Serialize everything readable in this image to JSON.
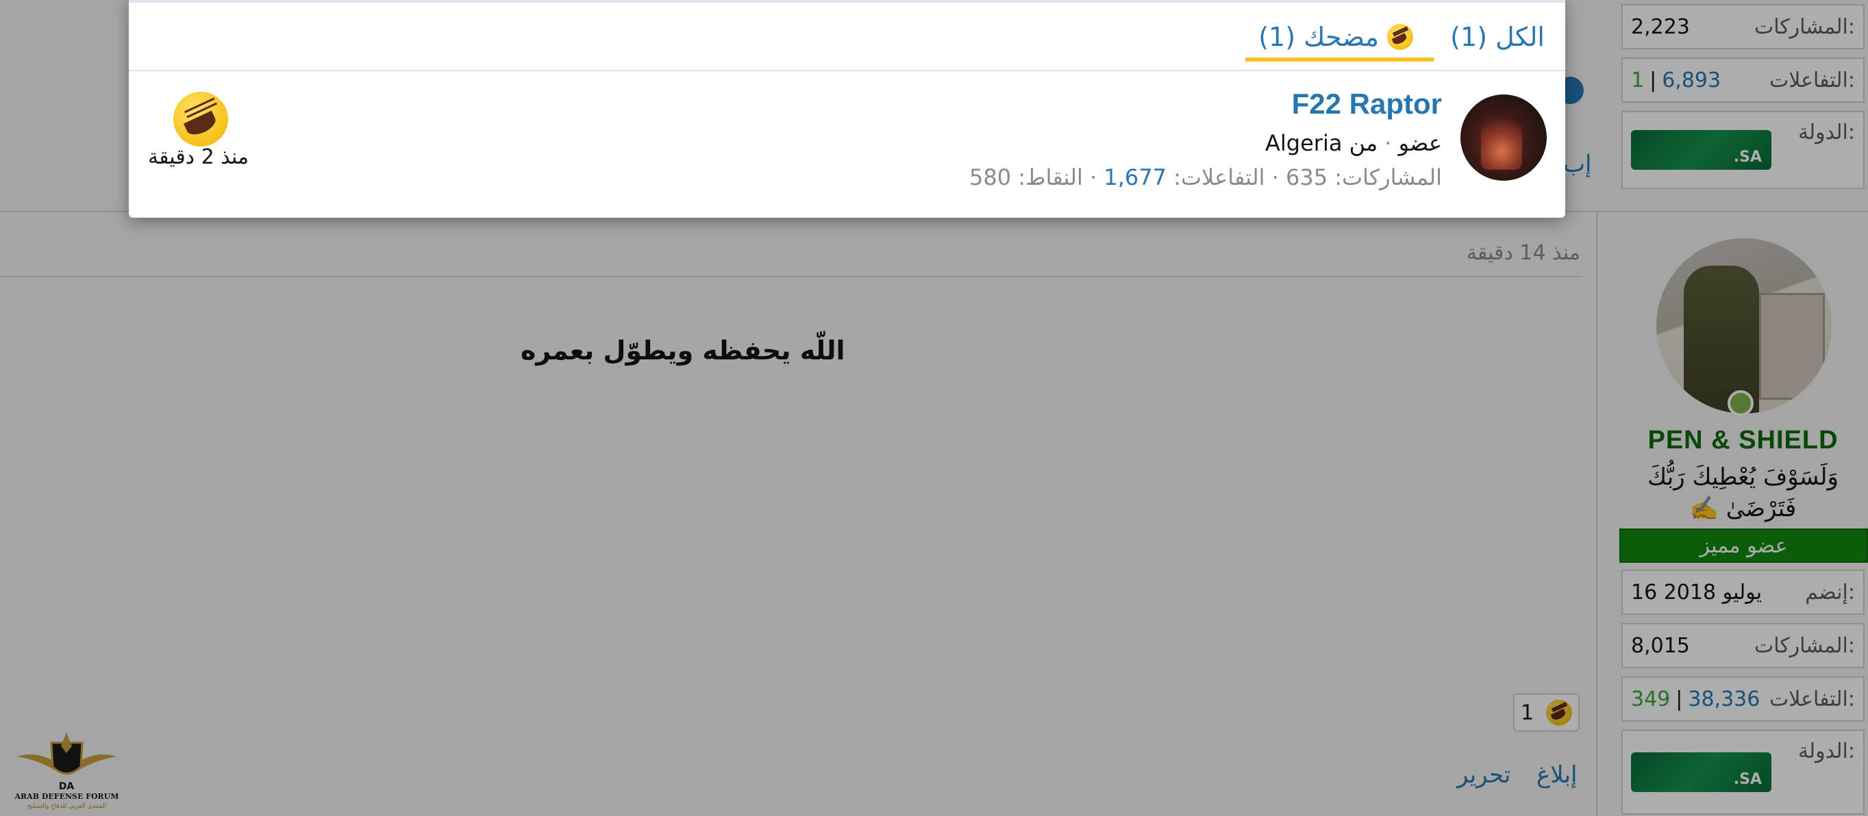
{
  "sidebar_top": {
    "posts_label": "المشاركات:",
    "posts_value": "2,223",
    "reactions_label": "التفاعلات:",
    "reactions_value": "6,893",
    "reactions_sep": "|",
    "reactions_extra": "1",
    "country_label": "الدولة:",
    "flag_text": ".SA"
  },
  "post": {
    "time": "منذ 14 دقيقة",
    "message": "اللّه يحفظه ويطوّل بعمره",
    "reaction_count": "1",
    "reaction_icon": "laughing-emoji",
    "actions": {
      "report": "إبلاغ",
      "edit": "تحرير"
    },
    "partial_action": "إب"
  },
  "author": {
    "name": "PEN & SHIELD",
    "title_line1": "وَلَسَوْفَ يُعْطِيكَ رَبُّكَ",
    "title_line2": "فَتَرْضَىٰ ✍️",
    "rank": "عضو مميز",
    "joined_label": "إنضم:",
    "joined_value": "16 يوليو 2018",
    "posts_label": "المشاركات:",
    "posts_value": "8,015",
    "reactions_label": "التفاعلات:",
    "reactions_value": "38,336",
    "reactions_sep": "|",
    "reactions_extra": "349",
    "country_label": "الدولة:",
    "flag_text": ".SA"
  },
  "modal": {
    "tabs": [
      {
        "label": "الكل (1)",
        "active": false
      },
      {
        "label": "مضحك (1)",
        "active": true,
        "icon": "laughing-emoji"
      }
    ],
    "reactor": {
      "name": "F22 Raptor",
      "role": "عضو",
      "from_label": "من",
      "location": "Algeria",
      "posts_label": "المشاركات:",
      "posts_value": "635",
      "reactions_label": "التفاعلات:",
      "reactions_value": "1,677",
      "points_label": "النقاط:",
      "points_value": "580",
      "time": "منذ 2 دقيقة",
      "reaction_icon": "laughing-emoji"
    }
  },
  "logo": {
    "text": "ARAB DEFENSE FORUM",
    "subtext": "المنتدى العربي للدفاع والتسليح"
  },
  "colors": {
    "accent": "#2577b1",
    "reaction_tab": "#f9c12d",
    "rank_bg": "#118a11",
    "username": "#0b6b0b"
  }
}
